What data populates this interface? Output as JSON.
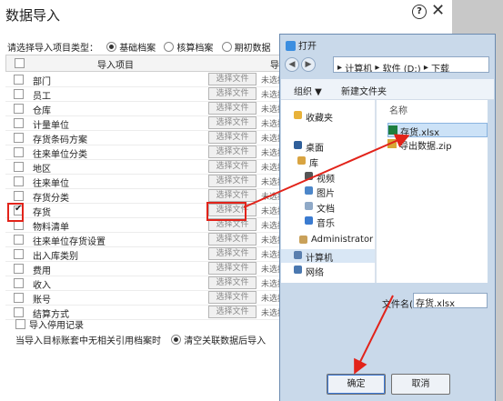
{
  "import_dialog": {
    "title": "数据导入",
    "help_glyph": "?",
    "close_glyph": "✕",
    "type_label": "请选择导入项目类型：",
    "types": [
      "基础档案",
      "核算档案",
      "期初数据"
    ],
    "selected_type": "基础档案",
    "header": {
      "item": "导入项目",
      "col2": "导"
    },
    "rows": [
      {
        "name": "部门",
        "btn": "选择文件",
        "status": "未选择",
        "checked": false
      },
      {
        "name": "员工",
        "btn": "选择文件",
        "status": "未选择",
        "checked": false
      },
      {
        "name": "仓库",
        "btn": "选择文件",
        "status": "未选择",
        "checked": false
      },
      {
        "name": "计量单位",
        "btn": "选择文件",
        "status": "未选择",
        "checked": false
      },
      {
        "name": "存货条码方案",
        "btn": "选择文件",
        "status": "未选择",
        "checked": false
      },
      {
        "name": "往来单位分类",
        "btn": "选择文件",
        "status": "未选择",
        "checked": false
      },
      {
        "name": "地区",
        "btn": "选择文件",
        "status": "未选择",
        "checked": false
      },
      {
        "name": "往来单位",
        "btn": "选择文件",
        "status": "未选择",
        "checked": false
      },
      {
        "name": "存货分类",
        "btn": "选择文件",
        "status": "未选择",
        "checked": false
      },
      {
        "name": "存货",
        "btn": "选择文件",
        "status": "未选择",
        "checked": true
      },
      {
        "name": "物料清单",
        "btn": "选择文件",
        "status": "未选择",
        "checked": false
      },
      {
        "name": "往来单位存货设置",
        "btn": "选择文件",
        "status": "未选择",
        "checked": false
      },
      {
        "name": "出入库类别",
        "btn": "选择文件",
        "status": "未选择",
        "checked": false
      },
      {
        "name": "费用",
        "btn": "选择文件",
        "status": "未选择",
        "checked": false
      },
      {
        "name": "收入",
        "btn": "选择文件",
        "status": "未选择",
        "checked": false
      },
      {
        "name": "账号",
        "btn": "选择文件",
        "status": "未选择",
        "checked": false
      },
      {
        "name": "结算方式",
        "btn": "选择文件",
        "status": "未选择",
        "checked": false
      }
    ],
    "import_disabled_label": "导入停用记录",
    "footer_label": "当导入目标账套中无相关引用档案时",
    "footer_option": "清空关联数据后导入"
  },
  "open_dialog": {
    "title": "打开",
    "back_glyph": "◀",
    "fwd_glyph": "▶",
    "address": [
      "计算机",
      "软件 (D:)",
      "下载"
    ],
    "organize": "组织 ▼",
    "new_folder": "新建文件夹",
    "nav_items": [
      {
        "label": "收藏夹",
        "icon": "star-icon",
        "color": "#e8b23a"
      },
      {
        "label": "桌面",
        "icon": "desktop-icon",
        "color": "#2f5f9a"
      },
      {
        "label": "库",
        "icon": "library-icon",
        "color": "#d9a441"
      },
      {
        "label": "视频",
        "icon": "video-icon",
        "color": "#555555"
      },
      {
        "label": "图片",
        "icon": "picture-icon",
        "color": "#4c86c9"
      },
      {
        "label": "文档",
        "icon": "document-icon",
        "color": "#8fa9c7"
      },
      {
        "label": "音乐",
        "icon": "music-icon",
        "color": "#3b7bd0"
      },
      {
        "label": "Administrator",
        "icon": "user-icon",
        "color": "#c9a15a"
      },
      {
        "label": "计算机",
        "icon": "computer-icon",
        "color": "#5a7fae"
      },
      {
        "label": "网络",
        "icon": "network-icon",
        "color": "#4a78b0"
      }
    ],
    "file_header": "名称",
    "files": [
      {
        "label": "存货.xlsx",
        "icon": "excel-icon",
        "color": "#1e7e3e",
        "selected": true
      },
      {
        "label": "导出数据.zip",
        "icon": "zip-icon",
        "color": "#d8a635",
        "selected": false
      }
    ],
    "filename_label": "文件名(N):",
    "filename_value": "存货.xlsx",
    "ok_label": "确定",
    "cancel_label": "取消"
  },
  "colors": {
    "annotation": "#e2231a",
    "dialog_frame": "#c9d9ea",
    "selection": "#cce2f7"
  }
}
